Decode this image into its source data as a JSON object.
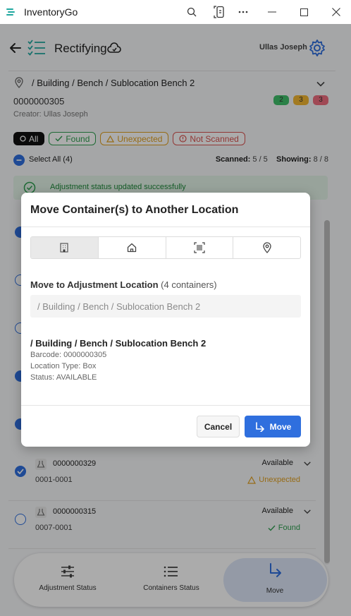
{
  "window": {
    "title": "InventoryGo"
  },
  "header": {
    "title": "Rectifying",
    "user": "Ullas Joseph"
  },
  "location": {
    "path": "/ Building / Bench / Sublocation Bench 2",
    "barcode": "0000000305",
    "creator": "Creator: Ullas Joseph"
  },
  "badges": [
    {
      "value": "2",
      "color": "#3fbf6b"
    },
    {
      "value": "3",
      "color": "#f2b632"
    },
    {
      "value": "3",
      "color": "#ef6e7f"
    }
  ],
  "filters": {
    "all": "All",
    "found": "Found",
    "unexpected": "Unexpected",
    "not_scanned": "Not Scanned"
  },
  "select_all": {
    "label": "Select All (4)",
    "scanned_label": "Scanned:",
    "scanned_value": "5 / 5",
    "showing_label": "Showing:",
    "showing_value": "8 / 8"
  },
  "banner": {
    "text": "Adjustment status updated successfully"
  },
  "items": [
    {
      "code": "0000000329",
      "sub": "0001-0001",
      "status": "Available",
      "tag": "Unexpected",
      "tag_color": "#e0a020",
      "checked": true
    },
    {
      "code": "0000000315",
      "sub": "0007-0001",
      "status": "Available",
      "tag": "Found",
      "tag_color": "#2e9e4f",
      "checked": false
    }
  ],
  "nav": {
    "adjustment": "Adjustment Status",
    "containers": "Containers Status",
    "move": "Move"
  },
  "modal": {
    "title": "Move Container(s) to Another Location",
    "move_label": "Move to Adjustment Location",
    "count": "(4 containers)",
    "placeholder": "/ Building / Bench / Sublocation Bench 2",
    "detail_title": "/ Building / Bench / Sublocation Bench 2",
    "detail_barcode": "Barcode: 0000000305",
    "detail_type": "Location Type: Box",
    "detail_status": "Status: AVAILABLE",
    "cancel": "Cancel",
    "move": "Move"
  },
  "colors": {
    "accent": "#2f6fde",
    "success": "#2e9e4f",
    "warning": "#e0a020",
    "danger": "#d9534f"
  }
}
